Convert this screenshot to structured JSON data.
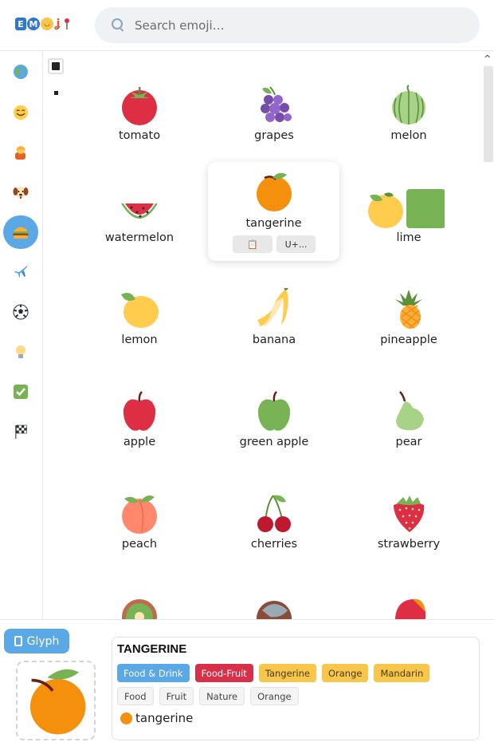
{
  "header": {
    "logo_letters": [
      "E",
      "M"
    ],
    "search_placeholder": "Search emoji…"
  },
  "sidebar": {
    "categories": [
      {
        "name": "travel-globe",
        "icon": "globe-icon"
      },
      {
        "name": "smileys",
        "icon": "smiley-icon"
      },
      {
        "name": "people",
        "icon": "person-icon"
      },
      {
        "name": "animals",
        "icon": "dog-icon"
      },
      {
        "name": "food",
        "icon": "burger-icon",
        "active": true
      },
      {
        "name": "travel",
        "icon": "airplane-icon"
      },
      {
        "name": "activities",
        "icon": "soccer-icon"
      },
      {
        "name": "objects",
        "icon": "lightbulb-icon"
      },
      {
        "name": "symbols",
        "icon": "checkmark-icon"
      },
      {
        "name": "flags",
        "icon": "checkered-flag-icon"
      }
    ]
  },
  "grid": {
    "items": [
      {
        "label": "tomato",
        "icon": "tomato-icon"
      },
      {
        "label": "grapes",
        "icon": "grapes-icon"
      },
      {
        "label": "melon",
        "icon": "melon-icon"
      },
      {
        "label": "watermelon",
        "icon": "watermelon-icon"
      },
      {
        "label": "tangerine",
        "icon": "tangerine-icon"
      },
      {
        "label": "lime",
        "icon": "lime-icon"
      },
      {
        "label": "lemon",
        "icon": "lemon-icon"
      },
      {
        "label": "banana",
        "icon": "banana-icon"
      },
      {
        "label": "pineapple",
        "icon": "pineapple-icon"
      },
      {
        "label": "apple",
        "icon": "red-apple-icon"
      },
      {
        "label": "green apple",
        "icon": "green-apple-icon"
      },
      {
        "label": "pear",
        "icon": "pear-icon"
      },
      {
        "label": "peach",
        "icon": "peach-icon"
      },
      {
        "label": "cherries",
        "icon": "cherries-icon"
      },
      {
        "label": "strawberry",
        "icon": "strawberry-icon"
      }
    ]
  },
  "popup": {
    "label": "tangerine",
    "copy_button": "📋",
    "code_button": "U+..."
  },
  "bottom": {
    "glyph_button": "Glyph",
    "title": "TANGERINE",
    "tags": [
      {
        "text": "Food & Drink",
        "style": "blue"
      },
      {
        "text": "Food-Fruit",
        "style": "red"
      },
      {
        "text": "Tangerine",
        "style": "yellow"
      },
      {
        "text": "Orange",
        "style": "yellow"
      },
      {
        "text": "Mandarin",
        "style": "yellow"
      },
      {
        "text": "Food",
        "style": "gray"
      },
      {
        "text": "Fruit",
        "style": "gray"
      },
      {
        "text": "Nature",
        "style": "gray"
      },
      {
        "text": "Orange",
        "style": "gray"
      }
    ],
    "name": "tangerine"
  },
  "colors": {
    "accent": "#5aa8e6",
    "tag_red": "#d9304a",
    "tag_yellow": "#f7c64a"
  }
}
